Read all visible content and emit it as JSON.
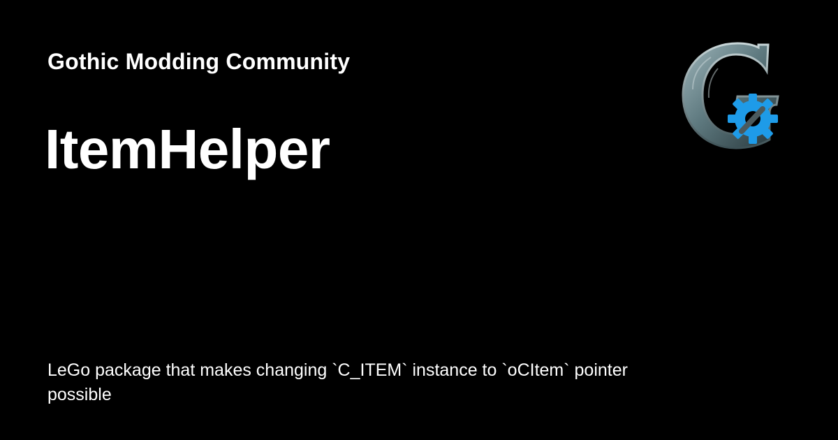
{
  "site": {
    "name": "Gothic Modding Community"
  },
  "page": {
    "title": "ItemHelper",
    "description": "LeGo package that makes changing `C_ITEM` instance to `oCItem` pointer possible"
  },
  "logo": {
    "icon": "gothic-g-gear-logo-icon",
    "colors": {
      "stone_light": "#8fa7ad",
      "stone_dark": "#2c3a3d",
      "gear": "#1e9be8",
      "background": "#000000"
    }
  }
}
